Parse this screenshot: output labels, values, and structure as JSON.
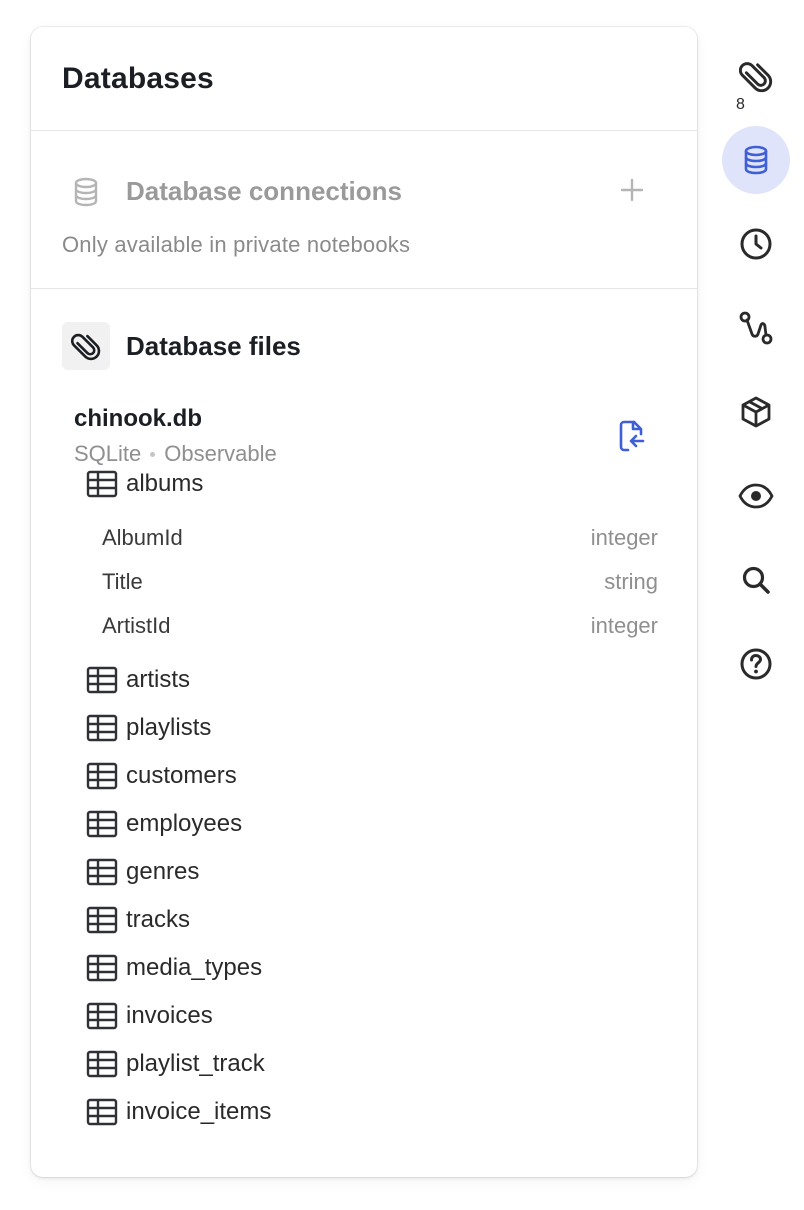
{
  "panel": {
    "title": "Databases"
  },
  "connections": {
    "title": "Database connections",
    "note": "Only available in private notebooks",
    "icon": "database-icon",
    "add_icon": "plus-icon"
  },
  "files": {
    "title": "Database files",
    "icon": "paperclip-icon",
    "database": {
      "name": "chinook.db",
      "type": "SQLite",
      "source": "Observable",
      "action_icon": "file-import-icon"
    },
    "tables": [
      {
        "name": "albums",
        "expanded": true
      },
      {
        "name": "artists"
      },
      {
        "name": "playlists"
      },
      {
        "name": "customers"
      },
      {
        "name": "employees"
      },
      {
        "name": "genres"
      },
      {
        "name": "tracks"
      },
      {
        "name": "media_types"
      },
      {
        "name": "invoices"
      },
      {
        "name": "playlist_track"
      },
      {
        "name": "invoice_items"
      }
    ],
    "albums_columns": [
      {
        "name": "AlbumId",
        "type": "integer"
      },
      {
        "name": "Title",
        "type": "string"
      },
      {
        "name": "ArtistId",
        "type": "integer"
      }
    ]
  },
  "rail": {
    "attachments_count": "8",
    "items": [
      {
        "icon": "paperclip-icon",
        "active": false
      },
      {
        "icon": "database-icon",
        "active": true
      },
      {
        "icon": "history-icon",
        "active": false
      },
      {
        "icon": "git-route-icon",
        "active": false
      },
      {
        "icon": "package-icon",
        "active": false
      },
      {
        "icon": "eye-icon",
        "active": false
      },
      {
        "icon": "search-icon",
        "active": false
      },
      {
        "icon": "help-icon",
        "active": false
      }
    ]
  },
  "colors": {
    "accent": "#3e5fd6",
    "active_bg": "#dfe4fb",
    "muted": "#9a9a9a"
  }
}
